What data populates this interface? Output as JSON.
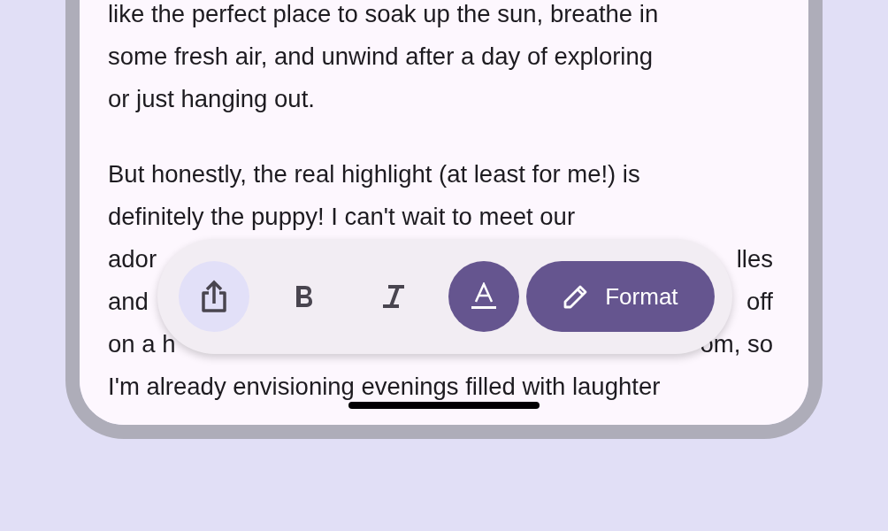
{
  "document": {
    "paragraphs": [
      {
        "lines": [
          {
            "text": "like the perfect place to soak up the sun, breathe in"
          },
          {
            "text": "some fresh air, and unwind after a day of exploring"
          },
          {
            "text": "or just hanging out."
          }
        ]
      },
      {
        "lines": [
          {
            "text": "But honestly, the real highlight (at least for me!) is"
          },
          {
            "text": "definitely the puppy! I can't wait to meet our"
          },
          {
            "left": "ador",
            "right": "lles"
          },
          {
            "left": "and",
            "right": "off"
          },
          {
            "left": "on a h",
            "right": "om, so"
          },
          {
            "text": "I'm already envisioning evenings filled with laughter"
          }
        ]
      }
    ]
  },
  "toolbar": {
    "buttons": [
      {
        "kind": "share"
      },
      {
        "kind": "bold"
      },
      {
        "kind": "italic"
      },
      {
        "kind": "text-color"
      },
      {
        "kind": "edit",
        "label": "Format"
      }
    ]
  }
}
